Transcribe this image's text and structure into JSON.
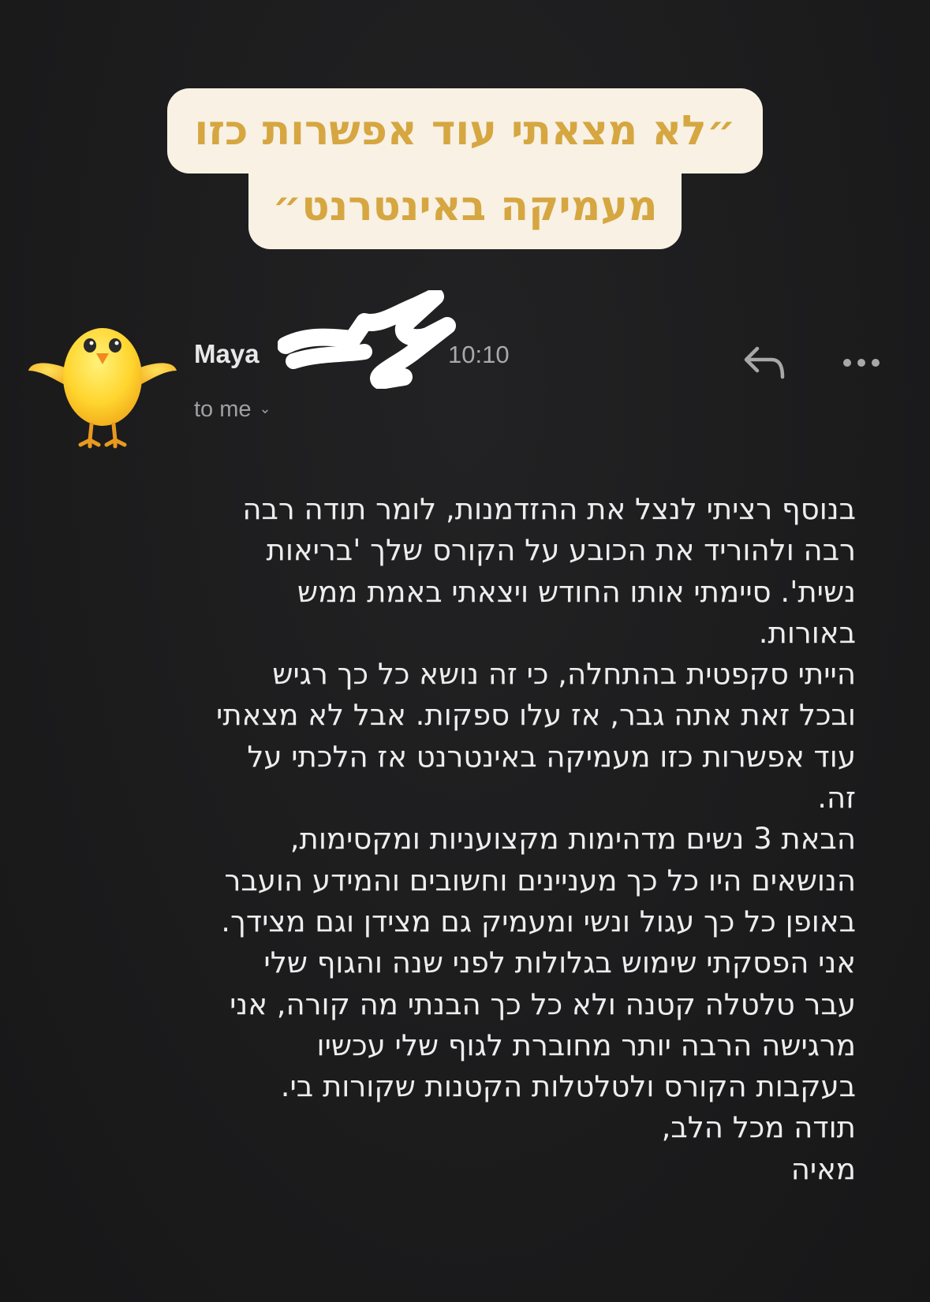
{
  "quote": {
    "line1": "״לא מצאתי עוד אפשרות כזו",
    "line2": "מעמיקה באינטרנט״",
    "bg_color": "#f8f1e4",
    "text_color": "#d6a640"
  },
  "email": {
    "sender_name": "Maya",
    "time": "10:10",
    "recipient": "to me",
    "avatar_icon": "baby-chick-emoji",
    "reply_icon": "reply-arrow-icon",
    "more_icon": "more-horizontal-icon",
    "body_lines": [
      "בנוסף רציתי לנצל את ההזדמנות, לומר תודה רבה",
      "רבה ולהוריד את הכובע על הקורס שלך 'בריאות",
      "נשית'. סיימתי אותו החודש ויצאתי באמת ממש",
      "באורות.",
      "הייתי סקפטית בהתחלה, כי זה נושא כל כך רגיש",
      "ובכל זאת אתה גבר, אז עלו ספקות. אבל לא מצאתי",
      "עוד אפשרות כזו מעמיקה באינטרנט אז הלכתי על",
      "זה.",
      "הבאת 3 נשים מדהימות מקצועניות ומקסימות,",
      "הנושאים היו כל כך מעניינים וחשובים והמידע הועבר",
      "באופן כל כך עגול ונשי ומעמיק גם מצידן וגם מצידך.",
      "אני הפסקתי שימוש בגלולות לפני שנה והגוף שלי",
      "עבר טלטלה קטנה ולא כל כך הבנתי מה קורה, אני",
      "מרגישה הרבה יותר מחוברת לגוף שלי עכשיו",
      "בעקבות הקורס ולטלטלות הקטנות שקורות בי.",
      "תודה מכל הלב,",
      "מאיה"
    ]
  }
}
